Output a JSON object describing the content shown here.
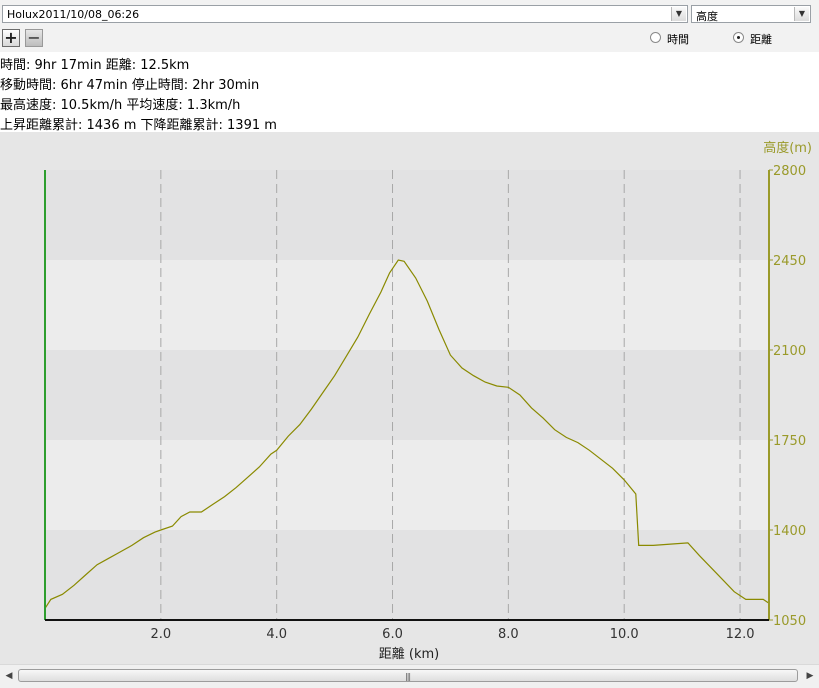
{
  "toolbar": {
    "track_select": "Holux2011/10/08_06:26",
    "metric_select": "高度",
    "zoom_in": "+",
    "zoom_out": "−",
    "axis_mode": [
      {
        "label": "時間",
        "selected": false
      },
      {
        "label": "距離",
        "selected": true
      }
    ]
  },
  "stats": {
    "line1": "時間: 9hr 17min 距離: 12.5km",
    "line2": "移動時間: 6hr 47min 停止時間: 2hr 30min",
    "line3": "最高速度: 10.5km/h 平均速度: 1.3km/h",
    "line4": "上昇距離累計: 1436 m 下降距離累計: 1391 m"
  },
  "scrollbar": {
    "grip": "|||"
  },
  "chart_data": {
    "type": "line",
    "xlabel": "距離 (km)",
    "ylabel": "高度(m)",
    "xlim": [
      0,
      12.5
    ],
    "ylim": [
      1050,
      2800
    ],
    "xticks": [
      2.0,
      4.0,
      6.0,
      8.0,
      10.0,
      12.0
    ],
    "yticks": [
      1050,
      1400,
      1750,
      2100,
      2450,
      2800
    ],
    "grid": "vertical dashed, horizontal bands",
    "colors": {
      "line": "#8a8a00",
      "axis_left": "#2e9e2e",
      "axis_right": "#9a9a2a",
      "band_light": "#ececec",
      "band_dark": "#e2e2e3"
    },
    "series": [
      {
        "x": [
          0,
          0.1,
          0.3,
          0.5,
          0.7,
          0.9,
          1.1,
          1.3,
          1.5,
          1.7,
          1.9,
          2.0,
          2.2,
          2.35,
          2.5,
          2.7,
          2.9,
          3.1,
          3.3,
          3.5,
          3.7,
          3.9,
          4.0,
          4.2,
          4.4,
          4.6,
          4.8,
          5.0,
          5.2,
          5.4,
          5.6,
          5.8,
          5.95,
          6.1,
          6.2,
          6.4,
          6.6,
          6.8,
          7.0,
          7.2,
          7.4,
          7.6,
          7.8,
          8.0,
          8.2,
          8.4,
          8.6,
          8.8,
          9.0,
          9.2,
          9.4,
          9.6,
          9.8,
          10.0,
          10.2,
          10.25,
          10.5,
          10.8,
          11.1,
          11.3,
          11.6,
          11.9,
          12.1,
          12.3,
          12.4,
          12.5
        ],
        "y": [
          1095,
          1130,
          1150,
          1185,
          1225,
          1265,
          1290,
          1315,
          1340,
          1370,
          1392,
          1400,
          1415,
          1452,
          1470,
          1470,
          1500,
          1530,
          1565,
          1605,
          1645,
          1695,
          1710,
          1765,
          1810,
          1870,
          1935,
          2000,
          2075,
          2150,
          2240,
          2325,
          2400,
          2450,
          2445,
          2380,
          2290,
          2180,
          2080,
          2030,
          2000,
          1975,
          1960,
          1955,
          1925,
          1875,
          1835,
          1790,
          1760,
          1740,
          1710,
          1675,
          1640,
          1595,
          1540,
          1340,
          1340,
          1345,
          1350,
          1300,
          1230,
          1160,
          1130,
          1130,
          1130,
          1115
        ]
      }
    ]
  }
}
